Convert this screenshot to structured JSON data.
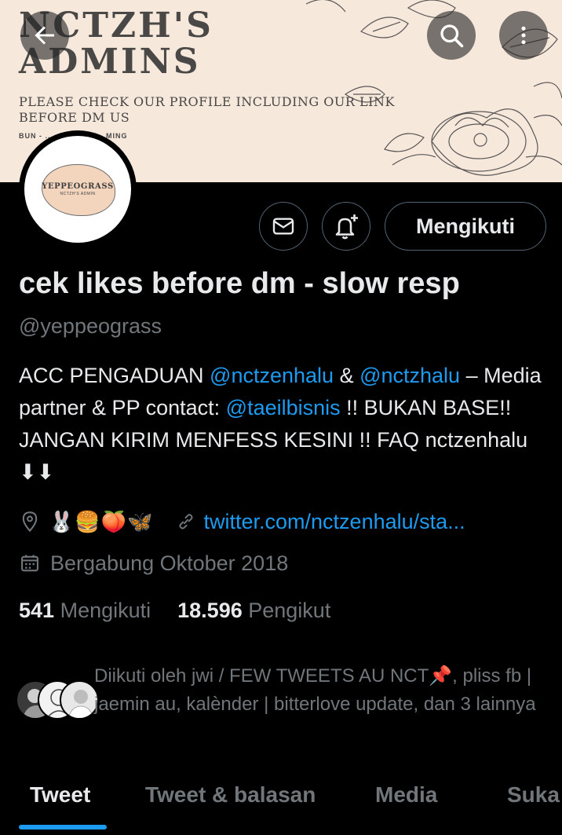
{
  "banner": {
    "title": "NCTZH'S\nADMINS",
    "note": "PLEASE CHECK OUR PROFILE INCLUDING OUR LINK\nBEFORE DM US",
    "names": "BUN - ... - BURGER - MING"
  },
  "header": {
    "back_icon": "arrow-left-icon",
    "search_icon": "search-icon",
    "more_icon": "more-vertical-icon"
  },
  "avatar": {
    "name": "YEPPEOGRASS",
    "subtitle": "NCTZH'S ADMIN"
  },
  "actions": {
    "message_icon": "mail-icon",
    "notify_icon": "bell-plus-icon",
    "follow_label": "Mengikuti"
  },
  "profile": {
    "display_name": "cek likes before dm - slow resp",
    "handle": "@yeppeograss",
    "bio": {
      "part1": "ACC PENGADUAN ",
      "mention1": "@nctzenhalu",
      "part2": " & ",
      "mention2": "@nctzhalu",
      "part3": " – Media partner & PP contact: ",
      "mention3": "@taeilbisnis",
      "part4": " !! BUKAN BASE!! JANGAN KIRIM MENFESS KESINI !! FAQ nctzenhalu ⬇⬇"
    },
    "location_emoji": "🐰🍔🍑🦋",
    "link": "twitter.com/nctzenhalu/sta...",
    "joined": "Bergabung Oktober 2018"
  },
  "stats": {
    "following_count": "541",
    "following_label": "Mengikuti",
    "followers_count": "18.596",
    "followers_label": "Pengikut"
  },
  "followed_by": "Diikuti oleh jwi / FEW TWEETS AU NCT📌, pliss fb | jaemin au, kalènder | bitterlove update, dan 3 lainnya",
  "tabs": [
    {
      "label": "Tweet"
    },
    {
      "label": "Tweet & balasan"
    },
    {
      "label": "Media"
    },
    {
      "label": "Suka"
    }
  ],
  "colors": {
    "accent": "#1d9bf0",
    "background": "#000000",
    "text_primary": "#e7e9ea",
    "text_secondary": "#71767b",
    "banner_bg": "#f6e9dc"
  }
}
